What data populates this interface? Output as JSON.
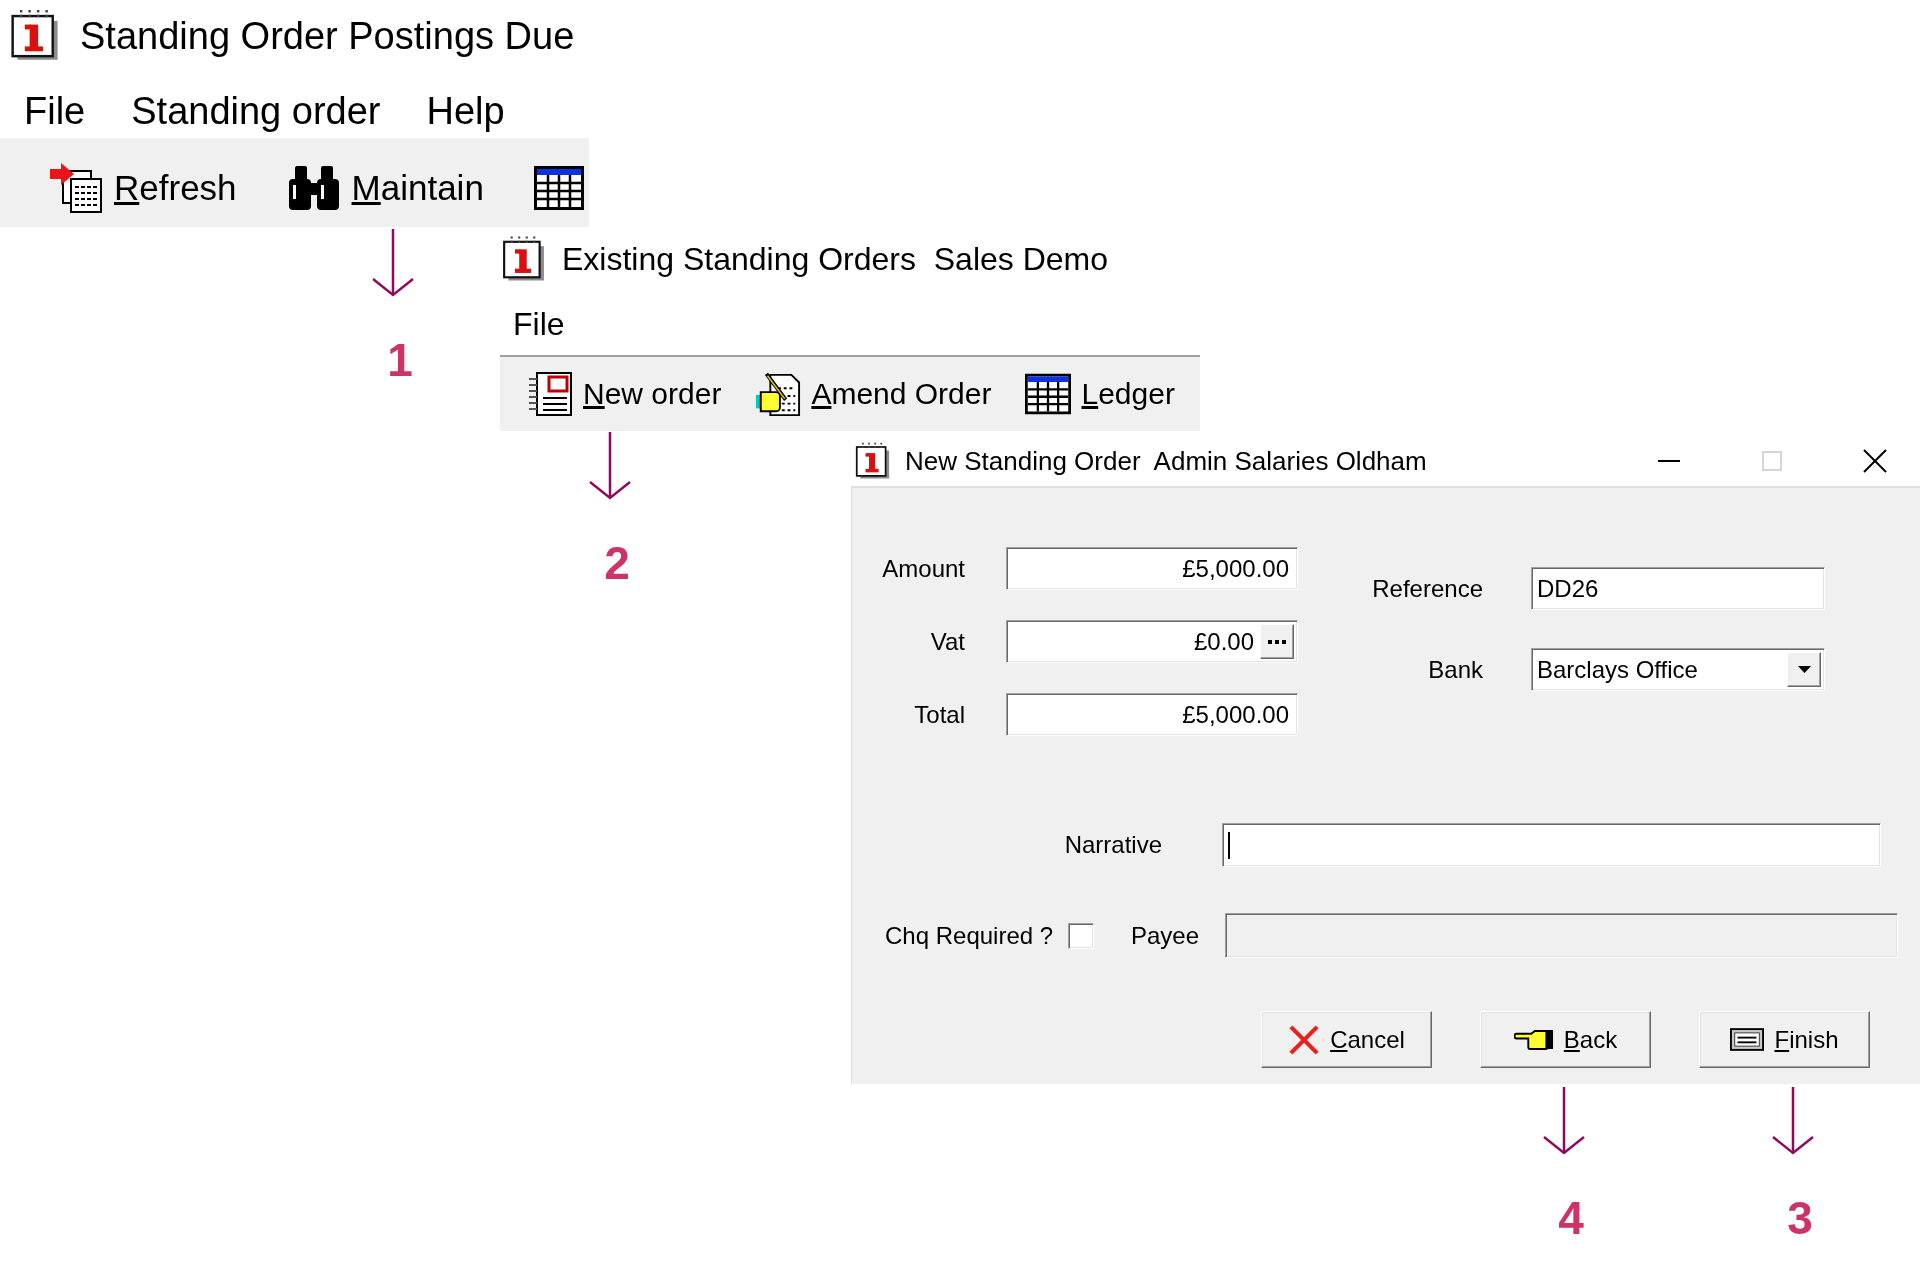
{
  "main_window": {
    "title": "Standing Order Postings Due",
    "menu": [
      "File",
      "Standing order",
      "Help"
    ],
    "toolbar": [
      "Refresh",
      "Maintain"
    ]
  },
  "orders_window": {
    "title": "Existing Standing Orders  Sales Demo",
    "menu": [
      "File"
    ],
    "toolbar": [
      "New order",
      "Amend Order",
      "Ledger"
    ]
  },
  "dialog": {
    "title": "New Standing Order  Admin Salaries Oldham",
    "maximize_disabled": true,
    "amount_fields": [
      {
        "label": "Amount",
        "kind": "text",
        "value": "£5,000.00"
      },
      {
        "label": "Vat",
        "kind": "lookup",
        "value": "£0.00"
      },
      {
        "label": "Total",
        "kind": "text",
        "value": "£5,000.00"
      }
    ],
    "account_fields": [
      {
        "label": "Reference",
        "kind": "text",
        "value": "DD26"
      },
      {
        "label": "Bank",
        "kind": "dropdown",
        "value": "Barclays Office"
      }
    ],
    "narrative": {
      "label": "Narrative",
      "focused": true
    },
    "cheque_required": {
      "label": "Chq Required ?",
      "checked": false
    },
    "payee": {
      "label": "Payee",
      "disabled": true
    },
    "buttons": [
      "Cancel",
      "Back",
      "Finish"
    ]
  },
  "annotations": [
    "1",
    "2",
    "4",
    "3"
  ]
}
